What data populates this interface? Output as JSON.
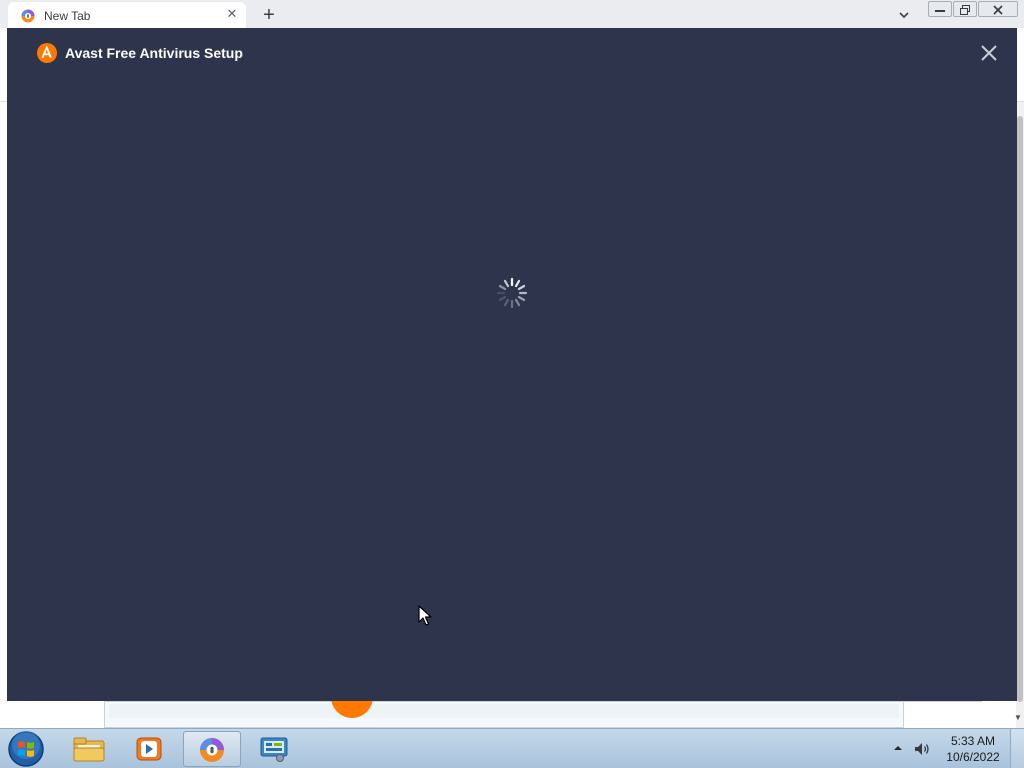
{
  "browser": {
    "tab": {
      "title": "New Tab"
    },
    "new_tab_icon": "plus-icon",
    "tab_close_icon": "close-icon"
  },
  "dialog": {
    "title": "Avast Free Antivirus Setup",
    "logo_icon": "avast-logo-icon",
    "close_icon": "close-icon",
    "state": "loading",
    "background": "#2d344b",
    "accent": "#ff7800"
  },
  "taskbar": {
    "items": [
      {
        "name": "Windows Explorer",
        "icon": "folder-icon"
      },
      {
        "name": "Windows Media Player",
        "icon": "media-player-icon"
      },
      {
        "name": "Browser",
        "icon": "browser-icon",
        "active": true
      },
      {
        "name": "Control Panel",
        "icon": "control-panel-icon"
      }
    ],
    "clock": {
      "time": "5:33 AM",
      "date": "10/6/2022"
    }
  }
}
